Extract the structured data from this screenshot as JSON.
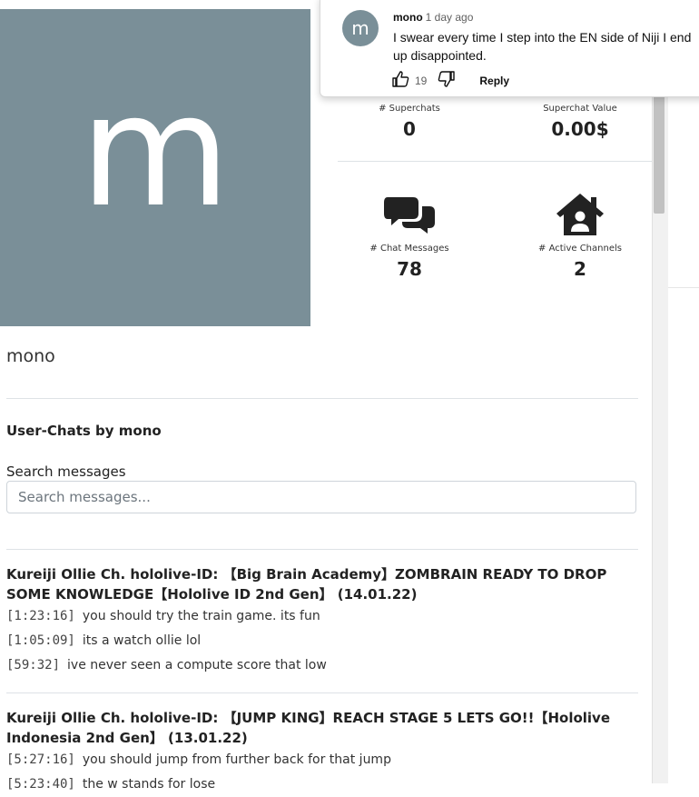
{
  "profile": {
    "avatar_letter": "m",
    "username": "mono"
  },
  "stats": {
    "superchats": {
      "label": "# Superchats",
      "value": "0"
    },
    "superchat_value": {
      "label": "Superchat Value",
      "value": "0.00$"
    },
    "chat_messages": {
      "label": "# Chat Messages",
      "value": "78",
      "icon": "comments-icon"
    },
    "active_channels": {
      "label": "# Active Channels",
      "value": "2",
      "icon": "house-user-icon"
    }
  },
  "chats": {
    "section_title": "User-Chats by mono",
    "search_label": "Search messages",
    "search_placeholder": "Search messages...",
    "streams": [
      {
        "title": "Kureiji Ollie Ch. hololive-ID: 【Big Brain Academy】ZOMBRAIN READY TO DROP SOME KNOWLEDGE【Hololive ID 2nd Gen】 (14.01.22)",
        "messages": [
          {
            "time": "[1:23:16]",
            "text": "you should try the train game. its fun"
          },
          {
            "time": "[1:05:09]",
            "text": "its a watch ollie lol"
          },
          {
            "time": "[59:32]",
            "text": "ive never seen a compute score that low"
          }
        ]
      },
      {
        "title": "Kureiji Ollie Ch. hololive-ID: 【JUMP KING】REACH STAGE 5 LETS GO!!【Hololive Indonesia 2nd Gen】 (13.01.22)",
        "messages": [
          {
            "time": "[5:27:16]",
            "text": "you should jump from further back for that jump"
          },
          {
            "time": "[5:23:40]",
            "text": "the w stands for lose"
          }
        ]
      }
    ]
  },
  "comment_popup": {
    "avatar_letter": "m",
    "author": "mono",
    "time": "1 day ago",
    "text": "I swear every time I step into the EN side of Niji I end up disappointed.",
    "likes": "19",
    "reply_label": "Reply"
  },
  "colors": {
    "avatar_bg": "#7a8f98",
    "divider": "#dee2e6",
    "text": "#212529"
  }
}
